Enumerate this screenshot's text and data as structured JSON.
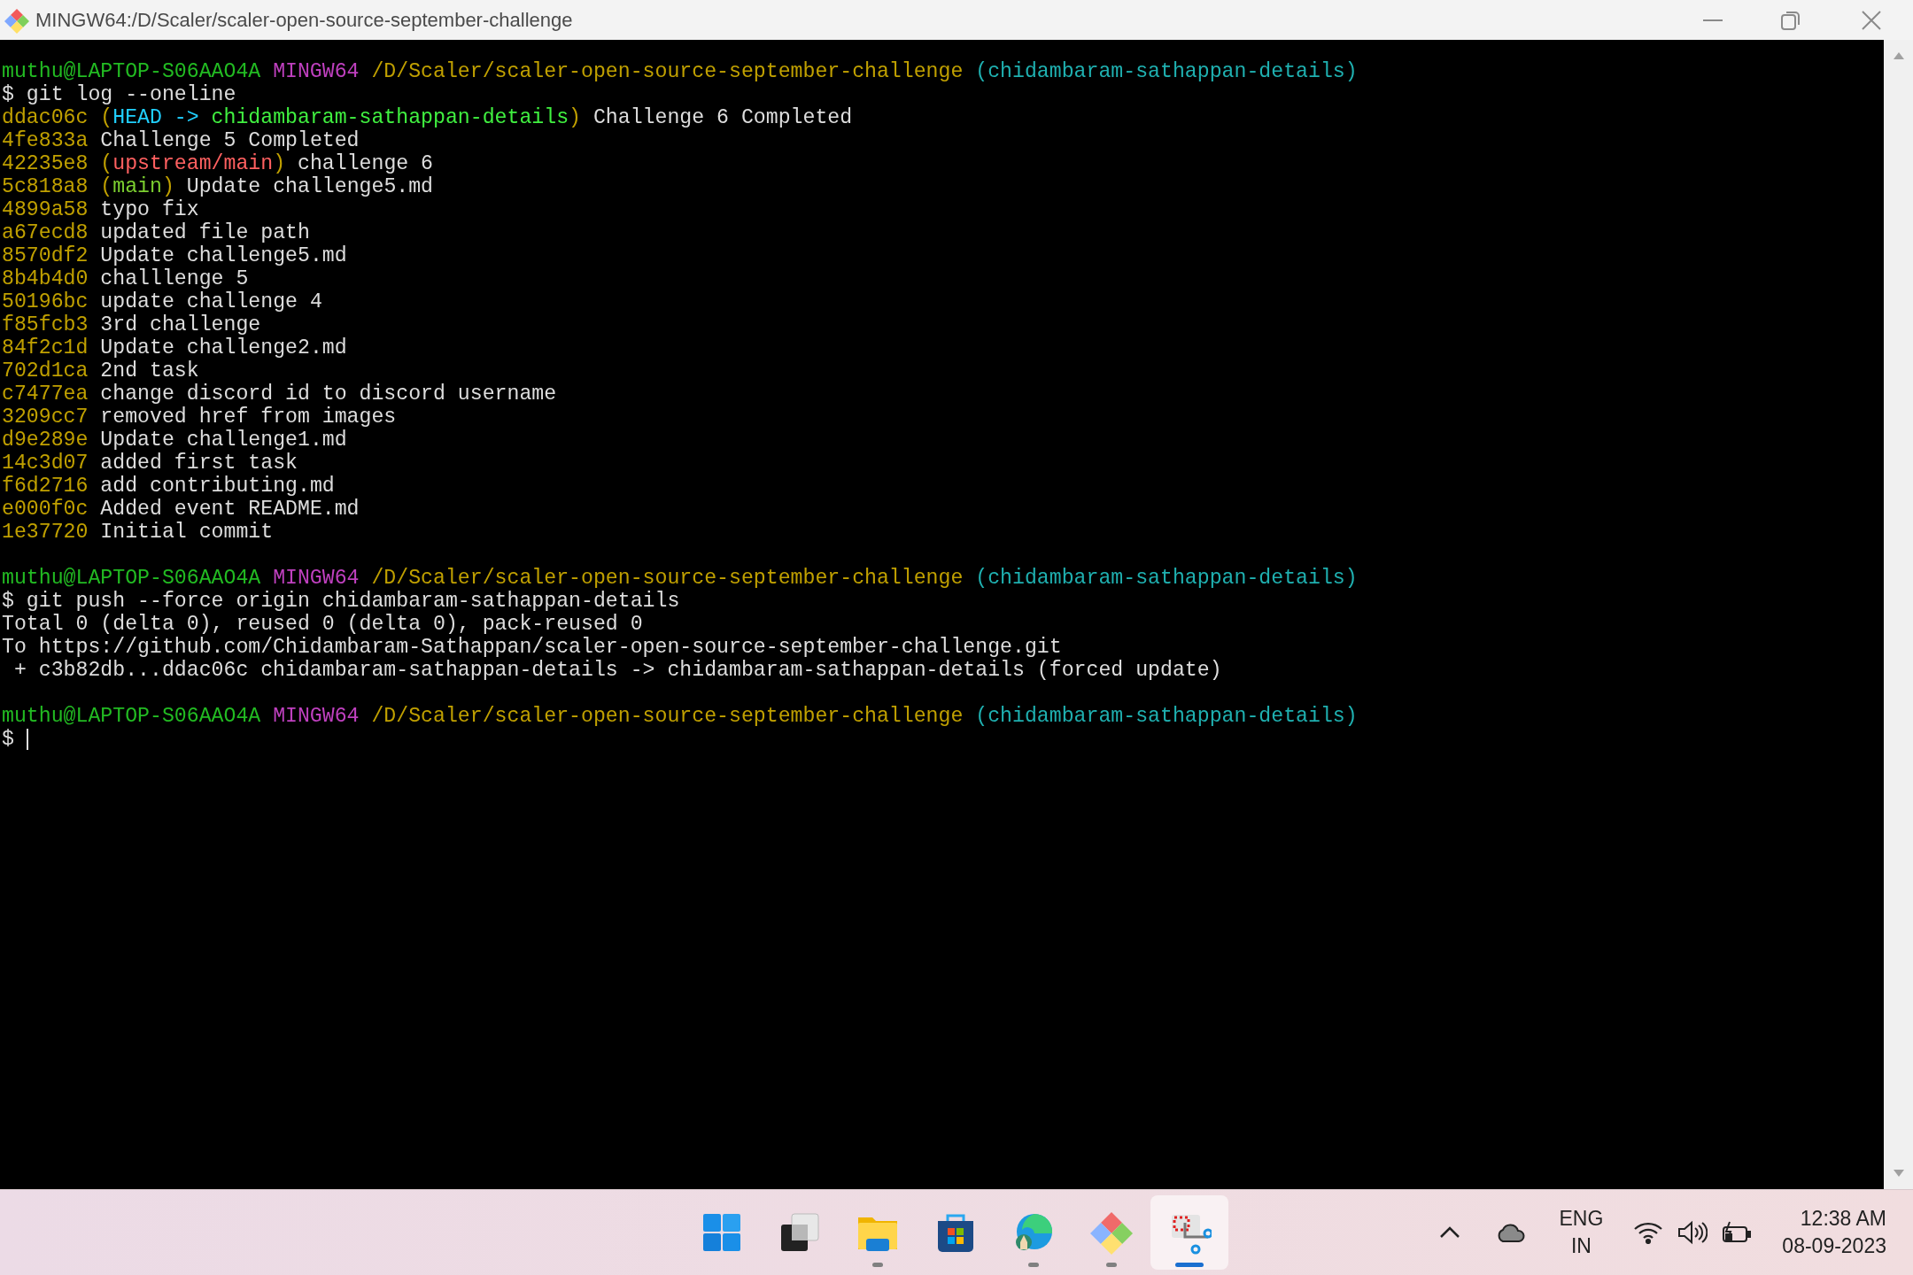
{
  "window": {
    "title": "MINGW64:/D/Scaler/scaler-open-source-september-challenge"
  },
  "terminal": {
    "lines": [
      {
        "kind": "text",
        "segments": [
          {
            "text": "muthu@LAPTOP-S06AAO4A ",
            "color": "#22bb22"
          },
          {
            "text": "MINGW64 ",
            "color": "#bf40bf"
          },
          {
            "text": "/D/Scaler/scaler-open-source-september-challenge ",
            "color": "#c0a000"
          },
          {
            "text": "(chidambaram-sathappan-details)",
            "color": "#1fb0b0"
          }
        ]
      },
      {
        "kind": "text",
        "segments": [
          {
            "text": "$ git log --oneline",
            "color": "#dddddd"
          }
        ]
      },
      {
        "kind": "text",
        "segments": [
          {
            "text": "ddac06c (",
            "color": "#c0a000"
          },
          {
            "text": "HEAD -> ",
            "color": "#20d0ff"
          },
          {
            "text": "chidambaram-sathappan-details",
            "color": "#40f040"
          },
          {
            "text": ")",
            "color": "#c0a000"
          },
          {
            "text": " Challenge 6 Completed",
            "color": "#dddddd"
          }
        ]
      },
      {
        "kind": "text",
        "segments": [
          {
            "text": "4fe833a ",
            "color": "#c0a000"
          },
          {
            "text": "Challenge 5 Completed",
            "color": "#dddddd"
          }
        ]
      },
      {
        "kind": "text",
        "segments": [
          {
            "text": "42235e8 (",
            "color": "#c0a000"
          },
          {
            "text": "upstream/main",
            "color": "#ff6060"
          },
          {
            "text": ")",
            "color": "#c0a000"
          },
          {
            "text": " challenge 6",
            "color": "#dddddd"
          }
        ]
      },
      {
        "kind": "text",
        "segments": [
          {
            "text": "5c818a8 (",
            "color": "#c0a000"
          },
          {
            "text": "main",
            "color": "#7ccf30"
          },
          {
            "text": ")",
            "color": "#c0a000"
          },
          {
            "text": " Update challenge5.md",
            "color": "#dddddd"
          }
        ]
      },
      {
        "kind": "text",
        "segments": [
          {
            "text": "4899a58 ",
            "color": "#c0a000"
          },
          {
            "text": "typo fix",
            "color": "#dddddd"
          }
        ]
      },
      {
        "kind": "text",
        "segments": [
          {
            "text": "a67ecd8 ",
            "color": "#c0a000"
          },
          {
            "text": "updated file path",
            "color": "#dddddd"
          }
        ]
      },
      {
        "kind": "text",
        "segments": [
          {
            "text": "8570df2 ",
            "color": "#c0a000"
          },
          {
            "text": "Update challenge5.md",
            "color": "#dddddd"
          }
        ]
      },
      {
        "kind": "text",
        "segments": [
          {
            "text": "8b4b4d0 ",
            "color": "#c0a000"
          },
          {
            "text": "challlenge 5",
            "color": "#dddddd"
          }
        ]
      },
      {
        "kind": "text",
        "segments": [
          {
            "text": "50196bc ",
            "color": "#c0a000"
          },
          {
            "text": "update challenge 4",
            "color": "#dddddd"
          }
        ]
      },
      {
        "kind": "text",
        "segments": [
          {
            "text": "f85fcb3 ",
            "color": "#c0a000"
          },
          {
            "text": "3rd challenge",
            "color": "#dddddd"
          }
        ]
      },
      {
        "kind": "text",
        "segments": [
          {
            "text": "84f2c1d ",
            "color": "#c0a000"
          },
          {
            "text": "Update challenge2.md",
            "color": "#dddddd"
          }
        ]
      },
      {
        "kind": "text",
        "segments": [
          {
            "text": "702d1ca ",
            "color": "#c0a000"
          },
          {
            "text": "2nd task",
            "color": "#dddddd"
          }
        ]
      },
      {
        "kind": "text",
        "segments": [
          {
            "text": "c7477ea ",
            "color": "#c0a000"
          },
          {
            "text": "change discord id to discord username",
            "color": "#dddddd"
          }
        ]
      },
      {
        "kind": "text",
        "segments": [
          {
            "text": "3209cc7 ",
            "color": "#c0a000"
          },
          {
            "text": "removed href from images",
            "color": "#dddddd"
          }
        ]
      },
      {
        "kind": "text",
        "segments": [
          {
            "text": "d9e289e ",
            "color": "#c0a000"
          },
          {
            "text": "Update challenge1.md",
            "color": "#dddddd"
          }
        ]
      },
      {
        "kind": "text",
        "segments": [
          {
            "text": "14c3d07 ",
            "color": "#c0a000"
          },
          {
            "text": "added first task",
            "color": "#dddddd"
          }
        ]
      },
      {
        "kind": "text",
        "segments": [
          {
            "text": "f6d2716 ",
            "color": "#c0a000"
          },
          {
            "text": "add contributing.md",
            "color": "#dddddd"
          }
        ]
      },
      {
        "kind": "text",
        "segments": [
          {
            "text": "e000f0c ",
            "color": "#c0a000"
          },
          {
            "text": "Added event README.md",
            "color": "#dddddd"
          }
        ]
      },
      {
        "kind": "text",
        "segments": [
          {
            "text": "1e37720 ",
            "color": "#c0a000"
          },
          {
            "text": "Initial commit",
            "color": "#dddddd"
          }
        ]
      },
      {
        "kind": "blank"
      },
      {
        "kind": "text",
        "segments": [
          {
            "text": "muthu@LAPTOP-S06AAO4A ",
            "color": "#22bb22"
          },
          {
            "text": "MINGW64 ",
            "color": "#bf40bf"
          },
          {
            "text": "/D/Scaler/scaler-open-source-september-challenge ",
            "color": "#c0a000"
          },
          {
            "text": "(chidambaram-sathappan-details)",
            "color": "#1fb0b0"
          }
        ]
      },
      {
        "kind": "text",
        "segments": [
          {
            "text": "$ git push --force origin chidambaram-sathappan-details",
            "color": "#dddddd"
          }
        ]
      },
      {
        "kind": "text",
        "segments": [
          {
            "text": "Total 0 (delta 0), reused 0 (delta 0), pack-reused 0",
            "color": "#dddddd"
          }
        ]
      },
      {
        "kind": "text",
        "segments": [
          {
            "text": "To https://github.com/Chidambaram-Sathappan/scaler-open-source-september-challenge.git",
            "color": "#dddddd"
          }
        ]
      },
      {
        "kind": "text",
        "segments": [
          {
            "text": " + c3b82db...ddac06c chidambaram-sathappan-details -> chidambaram-sathappan-details (forced update)",
            "color": "#dddddd"
          }
        ]
      },
      {
        "kind": "blank"
      },
      {
        "kind": "text",
        "segments": [
          {
            "text": "muthu@LAPTOP-S06AAO4A ",
            "color": "#22bb22"
          },
          {
            "text": "MINGW64 ",
            "color": "#bf40bf"
          },
          {
            "text": "/D/Scaler/scaler-open-source-september-challenge ",
            "color": "#c0a000"
          },
          {
            "text": "(chidambaram-sathappan-details)",
            "color": "#1fb0b0"
          }
        ]
      },
      {
        "kind": "input",
        "segments": [
          {
            "text": "$",
            "color": "#dddddd"
          }
        ]
      }
    ]
  },
  "taskbar": {
    "apps": [
      {
        "kind": "start",
        "running": false,
        "selected": false
      },
      {
        "kind": "taskview",
        "running": false,
        "selected": false
      },
      {
        "kind": "explorer",
        "running": true,
        "selected": false
      },
      {
        "kind": "store",
        "running": false,
        "selected": false
      },
      {
        "kind": "edge",
        "running": true,
        "selected": false
      },
      {
        "kind": "git",
        "running": true,
        "selected": false
      },
      {
        "kind": "snip",
        "running": true,
        "selected": true
      }
    ],
    "language": [
      "ENG",
      "IN"
    ],
    "time": "12:38 AM",
    "date": "08-09-2023"
  }
}
